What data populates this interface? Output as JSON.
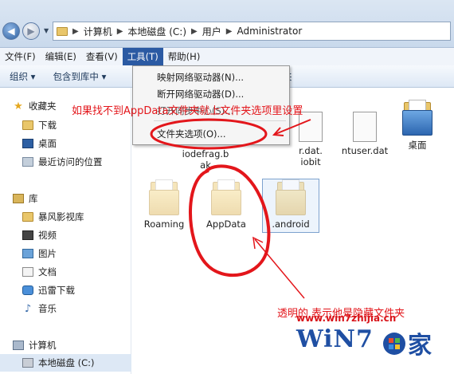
{
  "address": {
    "crumbs": [
      "计算机",
      "本地磁盘 (C:)",
      "用户",
      "Administrator"
    ]
  },
  "menubar": {
    "items": [
      "文件(F)",
      "编辑(E)",
      "查看(V)",
      "工具(T)",
      "帮助(H)"
    ]
  },
  "toolbar": {
    "organize": "组织 ▾",
    "include_library": "包含到库中 ▾",
    "new_partial": "夹"
  },
  "tools_menu": {
    "map_drive": "映射网络驱动器(N)...",
    "disconnect_drive": "断开网络驱动器(D)...",
    "open_sync": "打开同步中心(S)...",
    "folder_options": "文件夹选项(O)..."
  },
  "sidebar": {
    "favorites": "收藏夹",
    "downloads": "下载",
    "desktop": "桌面",
    "recent": "最近访问的位置",
    "libraries": "库",
    "baofeng": "暴风影视库",
    "videos": "视频",
    "pictures": "图片",
    "documents": "文档",
    "thunder": "迅雷下载",
    "music": "音乐",
    "computer": "计算机",
    "local_disk": "本地磁盘 (C:)"
  },
  "files": {
    "ntuser_dat": "r.dat.",
    "iobit": "iobit",
    "ntuser": "ntuser.dat",
    "desktop": "桌面",
    "iodefrag_1": "iodefrag.b",
    "iodefrag_2": "ak",
    "roaming": "Roaming",
    "appdata": "AppData",
    "android": ".android"
  },
  "annotations": {
    "top": "如果找不到AppData文件夹就上文件夹选项里设置",
    "bottom": "透明的  表示他是隐藏文件夹",
    "site": "www.win7zhijia.cn"
  },
  "logo": {
    "left": "WiN7",
    "right": "家"
  }
}
